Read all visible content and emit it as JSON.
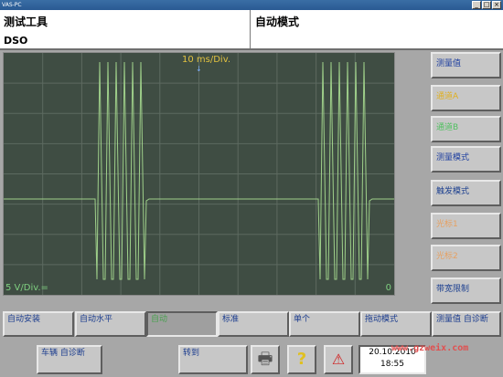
{
  "window": {
    "title": "VAS-PC",
    "buttons": [
      "_",
      "□",
      "×"
    ]
  },
  "header": {
    "left_title": "测试工具",
    "left_sub": "DSO",
    "right_title": "自动模式"
  },
  "scope": {
    "time_base": "10 ms/Div.",
    "volt_div": "5 V/Div.=",
    "zero_marker": "0",
    "trace_color": "#9fd08a"
  },
  "side_buttons": [
    {
      "label": "测量值",
      "color": "blue"
    },
    {
      "label": "通道A",
      "color": "yellow"
    },
    {
      "label": "通道B",
      "color": "green"
    },
    {
      "label": "测量模式",
      "color": "blue"
    },
    {
      "label": "触发模式",
      "color": "tealtxt"
    },
    {
      "label": "光标1",
      "color": "pale"
    },
    {
      "label": "光标2",
      "color": "pale"
    },
    {
      "label": "带宽限制",
      "color": "tealtxt"
    }
  ],
  "bottom_buttons": [
    {
      "label": "自动安装"
    },
    {
      "label": "自动水平"
    },
    {
      "label": "自动",
      "pressed": true
    },
    {
      "label": "标准"
    },
    {
      "label": "单个"
    },
    {
      "label": "拖动模式"
    },
    {
      "label": "测量值 自诊断"
    }
  ],
  "low_bar": {
    "vehicle_diag": "车辆 自诊断",
    "goto": "转到",
    "print_icon": "printer-icon",
    "help_icon": "help-icon",
    "warning_icon": "warning-icon",
    "date": "20.10.2010",
    "time": "18:55"
  },
  "watermark": "www.gzweix.com"
}
